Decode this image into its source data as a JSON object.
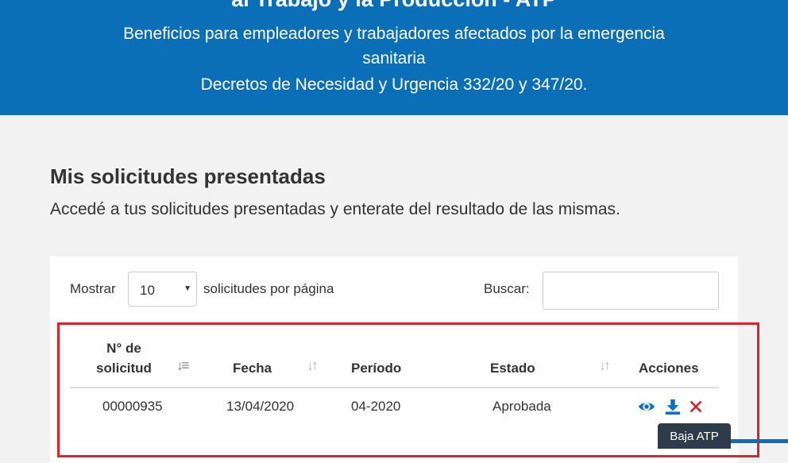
{
  "banner": {
    "title": "al Trabajo y la Producción - ATP",
    "subtitle": "Beneficios para empleadores y trabajadores afectados por la emergencia sanitaria",
    "decree": "Decretos de Necesidad y Urgencia 332/20 y 347/20."
  },
  "section": {
    "title": "Mis solicitudes presentadas",
    "description": "Accedé a tus solicitudes presentadas y enterate del resultado de las mismas."
  },
  "table_controls": {
    "show_label": "Mostrar",
    "page_length": "10",
    "per_page_label": "solicitudes por página",
    "search_label": "Buscar:",
    "search_value": ""
  },
  "table": {
    "columns": [
      {
        "line1": "N° de",
        "line2": "solicitud"
      },
      {
        "label": "Fecha"
      },
      {
        "label": "Período"
      },
      {
        "label": "Estado"
      },
      {
        "label": "Acciones"
      }
    ],
    "rows": [
      {
        "solicitud": "00000935",
        "fecha": "13/04/2020",
        "periodo": "04-2020",
        "estado": "Aprobada"
      }
    ]
  },
  "actions": {
    "view_icon": "eye-icon",
    "download_icon": "download-icon",
    "delete_icon": "close-icon",
    "tooltip": "Baja ATP"
  },
  "colors": {
    "brand_blue": "#0b6fb8",
    "highlight_red": "#d9232d",
    "action_blue": "#0b72c9",
    "delete_red": "#d9232d",
    "tooltip_bg": "#2d3b4a"
  }
}
